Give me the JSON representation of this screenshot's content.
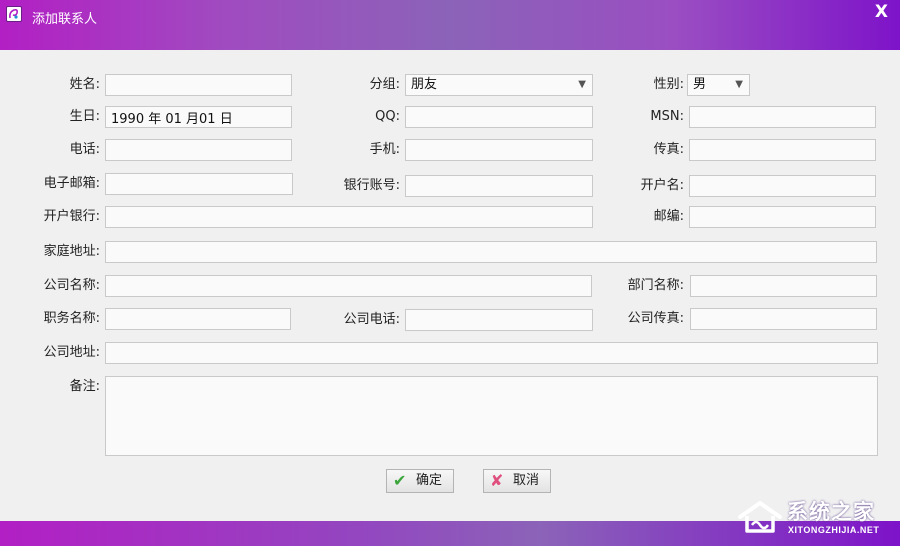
{
  "window": {
    "title": "添加联系人",
    "close_symbol": "X"
  },
  "form": {
    "name": {
      "label": "姓名:",
      "value": ""
    },
    "group": {
      "label": "分组:",
      "value": "朋友"
    },
    "gender": {
      "label": "性别:",
      "value": "男"
    },
    "birthday": {
      "label": "生日:",
      "value": "1990 年 01 月01 日"
    },
    "qq": {
      "label": "QQ:",
      "value": ""
    },
    "msn": {
      "label": "MSN:",
      "value": ""
    },
    "phone": {
      "label": "电话:",
      "value": ""
    },
    "mobile": {
      "label": "手机:",
      "value": ""
    },
    "fax": {
      "label": "传真:",
      "value": ""
    },
    "email": {
      "label": "电子邮箱:",
      "value": ""
    },
    "bank_account": {
      "label": "银行账号:",
      "value": ""
    },
    "account_name": {
      "label": "开户名:",
      "value": ""
    },
    "bank": {
      "label": "开户银行:",
      "value": ""
    },
    "postcode": {
      "label": "邮编:",
      "value": ""
    },
    "home_address": {
      "label": "家庭地址:",
      "value": ""
    },
    "company_name": {
      "label": "公司名称:",
      "value": ""
    },
    "department": {
      "label": "部门名称:",
      "value": ""
    },
    "job_title": {
      "label": "职务名称:",
      "value": ""
    },
    "company_phone": {
      "label": "公司电话:",
      "value": ""
    },
    "company_fax": {
      "label": "公司传真:",
      "value": ""
    },
    "company_address": {
      "label": "公司地址:",
      "value": ""
    },
    "notes": {
      "label": "备注:",
      "value": ""
    }
  },
  "buttons": {
    "confirm": {
      "label": "确定",
      "icon": "check-icon"
    },
    "cancel": {
      "label": "取消",
      "icon": "x-icon"
    }
  },
  "watermark": {
    "name": "系统之家",
    "domain": "XITONGZHIJIA.NET"
  },
  "colors": {
    "title_bar": "#9a4ec2",
    "check": "#3aa53a",
    "cancel_x": "#e0507e"
  }
}
